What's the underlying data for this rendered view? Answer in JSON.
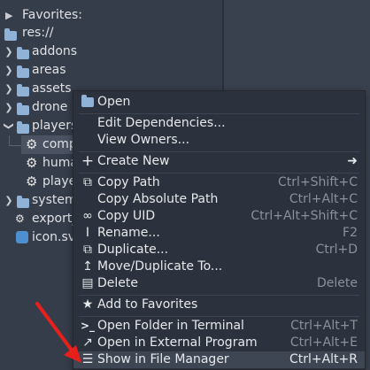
{
  "tree": {
    "favorites": "Favorites:",
    "root": "res://",
    "items": [
      {
        "label": "addons"
      },
      {
        "label": "areas"
      },
      {
        "label": "assets"
      },
      {
        "label": "drone"
      },
      {
        "label": "players"
      },
      {
        "label": "comp"
      },
      {
        "label": "huma"
      },
      {
        "label": "playe"
      },
      {
        "label": "system"
      },
      {
        "label": "export_"
      },
      {
        "label": "icon.sv"
      }
    ]
  },
  "context_menu": {
    "items": [
      {
        "label": "Open",
        "shortcut": "",
        "icon": "folder-open-icon"
      },
      {
        "label": "Edit Dependencies...",
        "shortcut": "",
        "icon": ""
      },
      {
        "label": "View Owners...",
        "shortcut": "",
        "icon": ""
      },
      {
        "label": "Create New",
        "shortcut": "",
        "icon": "plus-icon",
        "submenu": "➜"
      },
      {
        "label": "Copy Path",
        "shortcut": "Ctrl+Shift+C",
        "icon": "copy-icon"
      },
      {
        "label": "Copy Absolute Path",
        "shortcut": "Ctrl+Alt+C",
        "icon": ""
      },
      {
        "label": "Copy UID",
        "shortcut": "Ctrl+Alt+Shift+C",
        "icon": "link-icon"
      },
      {
        "label": "Rename...",
        "shortcut": "F2",
        "icon": "rename-icon"
      },
      {
        "label": "Duplicate...",
        "shortcut": "Ctrl+D",
        "icon": "duplicate-icon"
      },
      {
        "label": "Move/Duplicate To...",
        "shortcut": "",
        "icon": "move-icon"
      },
      {
        "label": "Delete",
        "shortcut": "Delete",
        "icon": "trash-icon"
      },
      {
        "label": "Add to Favorites",
        "shortcut": "",
        "icon": "star-icon"
      },
      {
        "label": "Open Folder in Terminal",
        "shortcut": "Ctrl+Alt+T",
        "icon": "terminal-icon"
      },
      {
        "label": "Open in External Program",
        "shortcut": "Ctrl+Alt+E",
        "icon": "external-icon"
      },
      {
        "label": "Show in File Manager",
        "shortcut": "Ctrl+Alt+R",
        "icon": "file-manager-icon"
      }
    ]
  },
  "colors": {
    "background": "#363d4a",
    "menu_bg": "#2c323d",
    "folder_icon": "#8fb2d6",
    "annotation_arrow": "#e8201c"
  }
}
